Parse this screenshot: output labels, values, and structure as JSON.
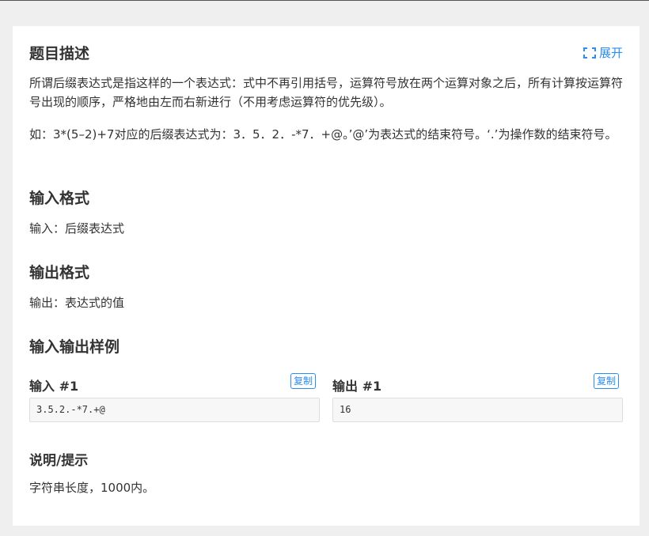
{
  "problem": {
    "description_title": "题目描述",
    "expand_label": "展开",
    "description_p1": "所谓后缀表达式是指这样的一个表达式：式中不再引用括号，运算符号放在两个运算对象之后，所有计算按运算符号出现的顺序，严格地由左而右新进行（不用考虑运算符的优先级）。",
    "description_p2": "如：3*(5–2)+7对应的后缀表达式为：3．5．2．-*7．+@。’@’为表达式的结束符号。‘.’为操作数的结束符号。",
    "input_title": "输入格式",
    "input_text": "输入：后缀表达式",
    "output_title": "输出格式",
    "output_text": "输出：表达式的值",
    "samples_title": "输入输出样例",
    "samples": {
      "input_label": "输入 #1",
      "output_label": "输出 #1",
      "copy_label": "复制",
      "input_value": "3.5.2.-*7.+@",
      "output_value": "16"
    },
    "hint_title": "说明/提示",
    "hint_text": "字符串长度，1000内。"
  },
  "colors": {
    "accent": "#2d8cf0",
    "background": "#efefef",
    "card": "#ffffff",
    "text": "#333333"
  },
  "icons": {
    "expand": "expand-icon"
  }
}
